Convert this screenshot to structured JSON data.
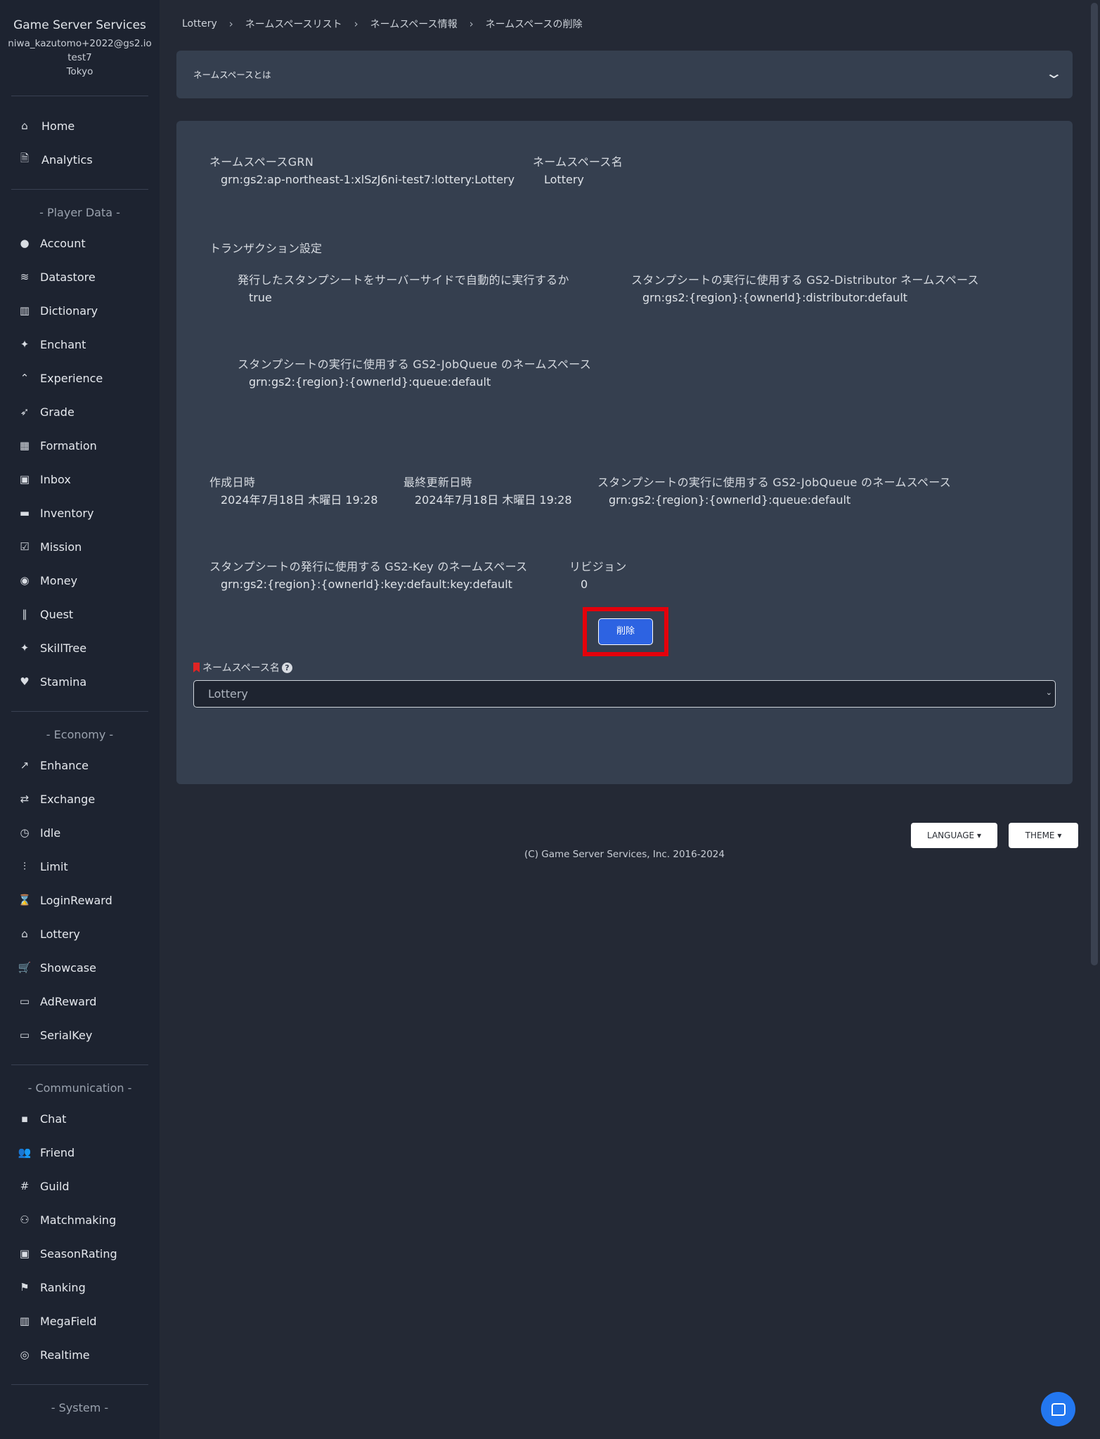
{
  "sidebar": {
    "brand": "Game Server Services",
    "user_email": "niwa_kazutomo+2022@gs2.io",
    "project": "test7",
    "region": "Tokyo",
    "top_items": [
      {
        "label": "Home",
        "icon": "home-icon",
        "glyph": "⌂"
      },
      {
        "label": "Analytics",
        "icon": "document-icon",
        "glyph": "🗎"
      }
    ],
    "sections": [
      {
        "title": "- Player Data -",
        "items": [
          {
            "label": "Account",
            "icon": "user-circle-icon",
            "glyph": "●"
          },
          {
            "label": "Datastore",
            "icon": "database-icon",
            "glyph": "≋"
          },
          {
            "label": "Dictionary",
            "icon": "book-icon",
            "glyph": "▥"
          },
          {
            "label": "Enchant",
            "icon": "sparkles-icon",
            "glyph": "✦"
          },
          {
            "label": "Experience",
            "icon": "chevrons-up-icon",
            "glyph": "⌃"
          },
          {
            "label": "Grade",
            "icon": "rocket-icon",
            "glyph": "➶"
          },
          {
            "label": "Formation",
            "icon": "grid-icon",
            "glyph": "▦"
          },
          {
            "label": "Inbox",
            "icon": "gift-icon",
            "glyph": "▣"
          },
          {
            "label": "Inventory",
            "icon": "briefcase-icon",
            "glyph": "▬"
          },
          {
            "label": "Mission",
            "icon": "clipboard-check-icon",
            "glyph": "☑"
          },
          {
            "label": "Money",
            "icon": "coin-icon",
            "glyph": "◉"
          },
          {
            "label": "Quest",
            "icon": "books-icon",
            "glyph": "∥"
          },
          {
            "label": "SkillTree",
            "icon": "sparkles-icon",
            "glyph": "✦"
          },
          {
            "label": "Stamina",
            "icon": "heart-icon",
            "glyph": "♥"
          }
        ]
      },
      {
        "title": "- Economy -",
        "items": [
          {
            "label": "Enhance",
            "icon": "trending-up-icon",
            "glyph": "↗"
          },
          {
            "label": "Exchange",
            "icon": "exchange-icon",
            "glyph": "⇄"
          },
          {
            "label": "Idle",
            "icon": "clock-icon",
            "glyph": "◷"
          },
          {
            "label": "Limit",
            "icon": "sliders-icon",
            "glyph": "⫶"
          },
          {
            "label": "LoginReward",
            "icon": "hourglass-icon",
            "glyph": "⌛"
          },
          {
            "label": "Lottery",
            "icon": "bank-icon",
            "glyph": "⌂"
          },
          {
            "label": "Showcase",
            "icon": "cart-icon",
            "glyph": "🛒"
          },
          {
            "label": "AdReward",
            "icon": "browser-icon",
            "glyph": "▭"
          },
          {
            "label": "SerialKey",
            "icon": "ticket-icon",
            "glyph": "▭"
          }
        ]
      },
      {
        "title": "- Communication -",
        "items": [
          {
            "label": "Chat",
            "icon": "chat-icon",
            "glyph": "▪"
          },
          {
            "label": "Friend",
            "icon": "users-icon",
            "glyph": "👥"
          },
          {
            "label": "Guild",
            "icon": "hash-icon",
            "glyph": "#"
          },
          {
            "label": "Matchmaking",
            "icon": "group-icon",
            "glyph": "⚇"
          },
          {
            "label": "SeasonRating",
            "icon": "monitor-icon",
            "glyph": "▣"
          },
          {
            "label": "Ranking",
            "icon": "flag-icon",
            "glyph": "⚑"
          },
          {
            "label": "MegaField",
            "icon": "map-icon",
            "glyph": "▥"
          },
          {
            "label": "Realtime",
            "icon": "broadcast-icon",
            "glyph": "◎"
          }
        ]
      },
      {
        "title": "- System -",
        "items": []
      }
    ]
  },
  "breadcrumb": [
    "Lottery",
    "ネームスペースリスト",
    "ネームスペース情報",
    "ネームスペースの削除"
  ],
  "about": {
    "label": "ネームスペースとは",
    "icon": "chevron-down-icon"
  },
  "details": {
    "grn_label": "ネームスペースGRN",
    "grn_value": "grn:gs2:ap-northeast-1:xlSzJ6ni-test7:lottery:Lottery",
    "name_label": "ネームスペース名",
    "name_value": "Lottery",
    "transaction_title": "トランザクション設定",
    "auto_run_label": "発行したスタンプシートをサーバーサイドで自動的に実行するか",
    "auto_run_value": "true",
    "distributor_label": "スタンプシートの実行に使用する GS2-Distributor ネームスペース",
    "distributor_value": "grn:gs2:{region}:{ownerId}:distributor:default",
    "jobqueue_label": "スタンプシートの実行に使用する GS2-JobQueue のネームスペース",
    "jobqueue_value": "grn:gs2:{region}:{ownerId}:queue:default",
    "created_label": "作成日時",
    "created_value": "2024年7月18日 木曜日 19:28",
    "updated_label": "最終更新日時",
    "updated_value": "2024年7月18日 木曜日 19:28",
    "jobqueue2_label": "スタンプシートの実行に使用する GS2-JobQueue のネームスペース",
    "jobqueue2_value": "grn:gs2:{region}:{ownerId}:queue:default",
    "key_label": "スタンプシートの発行に使用する GS2-Key のネームスペース",
    "key_value": "grn:gs2:{region}:{ownerId}:key:default:key:default",
    "revision_label": "リビジョン",
    "revision_value": "0"
  },
  "form": {
    "label": "ネームスペース名",
    "help": "?",
    "selected": "Lottery",
    "delete_button": "削除"
  },
  "footer": {
    "language": "LANGUAGE ▾",
    "theme": "THEME ▾",
    "copyright": "(C) Game Server Services, Inc. 2016-2024"
  },
  "colors": {
    "accent": "#2d63e2",
    "highlight": "#e5000b",
    "card": "#353f4f",
    "sidebar": "#1d2330"
  }
}
